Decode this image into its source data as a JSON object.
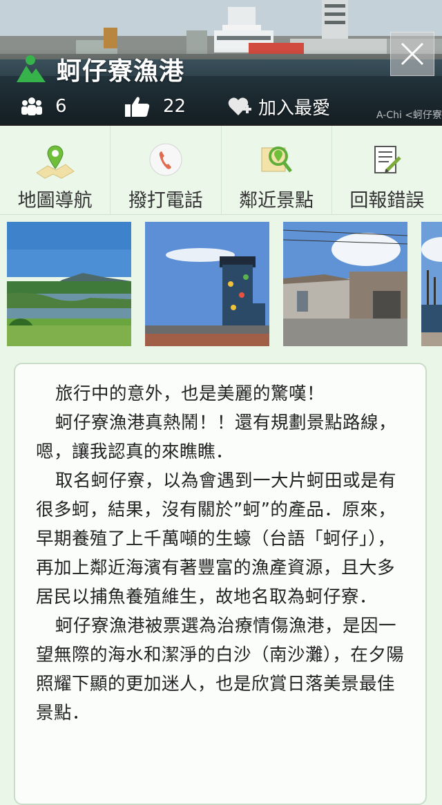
{
  "header": {
    "title": "蚵仔寮漁港",
    "visitors_count": "6",
    "likes_count": "22",
    "favorite_label": "加入最愛",
    "watermark": "A-Chi <蚵仔寮",
    "accent_color": "#36b34a"
  },
  "actions": [
    {
      "label": "地圖導航",
      "icon": "map-pin-icon"
    },
    {
      "label": "撥打電話",
      "icon": "phone-icon"
    },
    {
      "label": "鄰近景點",
      "icon": "nearby-search-icon"
    },
    {
      "label": "回報錯誤",
      "icon": "report-edit-icon"
    }
  ],
  "gallery": {
    "photos": [
      "river-wetland-photo",
      "lighthouse-photo",
      "village-street-photo",
      "harbor-boats-photo"
    ]
  },
  "description": {
    "paragraphs": [
      "旅行中的意外，也是美麗的驚嘆！",
      "蚵仔寮漁港真熱鬧！！還有規劃景點路線，嗯，讓我認真的來瞧瞧．",
      "取名蚵仔寮，以為會遇到一大片蚵田或是有很多蚵，結果，沒有關於”蚵”的產品．原來，早期養殖了上千萬噸的生蠔（台語「蚵仔」），再加上鄰近海濱有著豐富的漁產資源，且大多居民以捕魚養殖維生，故地名取為蚵仔寮．",
      "蚵仔寮漁港被票選為治療情傷漁港，是因一望無際的海水和潔淨的白沙（南沙灘），在夕陽照耀下顯的更加迷人，也是欣賞日落美景最佳景點．"
    ]
  }
}
